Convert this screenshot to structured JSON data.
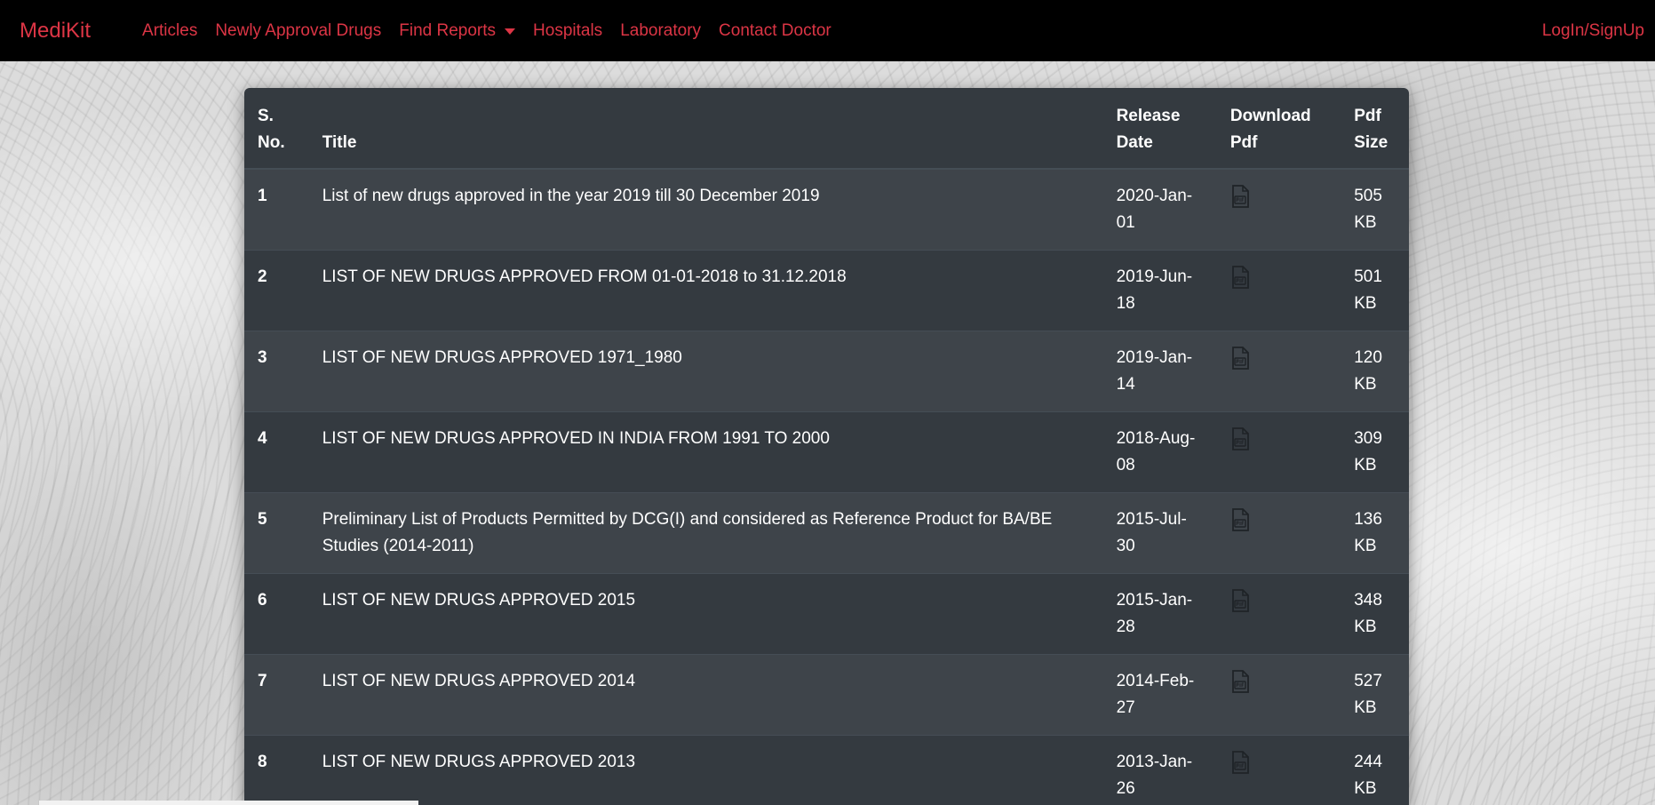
{
  "navbar": {
    "brand": "MediKit",
    "links": [
      {
        "label": "Articles"
      },
      {
        "label": "Newly Approval Drugs"
      },
      {
        "label": "Find Reports"
      },
      {
        "label": "Hospitals"
      },
      {
        "label": "Laboratory"
      },
      {
        "label": "Contact Doctor"
      }
    ],
    "login": "LogIn/SignUp"
  },
  "table": {
    "headers": {
      "sno": [
        "S.",
        "No."
      ],
      "title": "Title",
      "date": [
        "Release",
        "Date"
      ],
      "download": [
        "Download",
        "Pdf"
      ],
      "size": [
        "Pdf",
        "Size"
      ]
    },
    "rows": [
      {
        "sno": "1",
        "title": "List of new drugs approved in the year 2019 till 30 December 2019",
        "date": [
          "2020-Jan-",
          "01"
        ],
        "size": [
          "505",
          "KB"
        ]
      },
      {
        "sno": "2",
        "title": "LIST OF NEW DRUGS APPROVED FROM 01-01-2018 to 31.12.2018",
        "date": [
          "2019-Jun-",
          "18"
        ],
        "size": [
          "501",
          "KB"
        ]
      },
      {
        "sno": "3",
        "title": "LIST OF NEW DRUGS APPROVED 1971_1980",
        "date": [
          "2019-Jan-",
          "14"
        ],
        "size": [
          "120",
          "KB"
        ]
      },
      {
        "sno": "4",
        "title": "LIST OF NEW DRUGS APPROVED IN INDIA FROM 1991 TO 2000",
        "date": [
          "2018-Aug-",
          "08"
        ],
        "size": [
          "309",
          "KB"
        ]
      },
      {
        "sno": "5",
        "title": [
          "Preliminary List of Products Permitted by DCG(I) and considered as Reference Product for BA/BE",
          "Studies (2014-2011)"
        ],
        "date": [
          "2015-Jul-",
          "30"
        ],
        "size": [
          "136",
          "KB"
        ]
      },
      {
        "sno": "6",
        "title": "LIST OF NEW DRUGS APPROVED 2015",
        "date": [
          "2015-Jan-",
          "28"
        ],
        "size": [
          "348",
          "KB"
        ]
      },
      {
        "sno": "7",
        "title": "LIST OF NEW DRUGS APPROVED 2014",
        "date": [
          "2014-Feb-",
          "27"
        ],
        "size": [
          "527",
          "KB"
        ]
      },
      {
        "sno": "8",
        "title": "LIST OF NEW DRUGS APPROVED 2013",
        "date": [
          "2013-Jan-",
          "26"
        ],
        "size": [
          "244",
          "KB"
        ]
      }
    ],
    "download_icon": "pdf-file-icon"
  },
  "colors": {
    "accent": "#dc3545",
    "navbar_bg": "#000000",
    "table_bg": "#343a40",
    "table_stripe": "#3e444a"
  }
}
